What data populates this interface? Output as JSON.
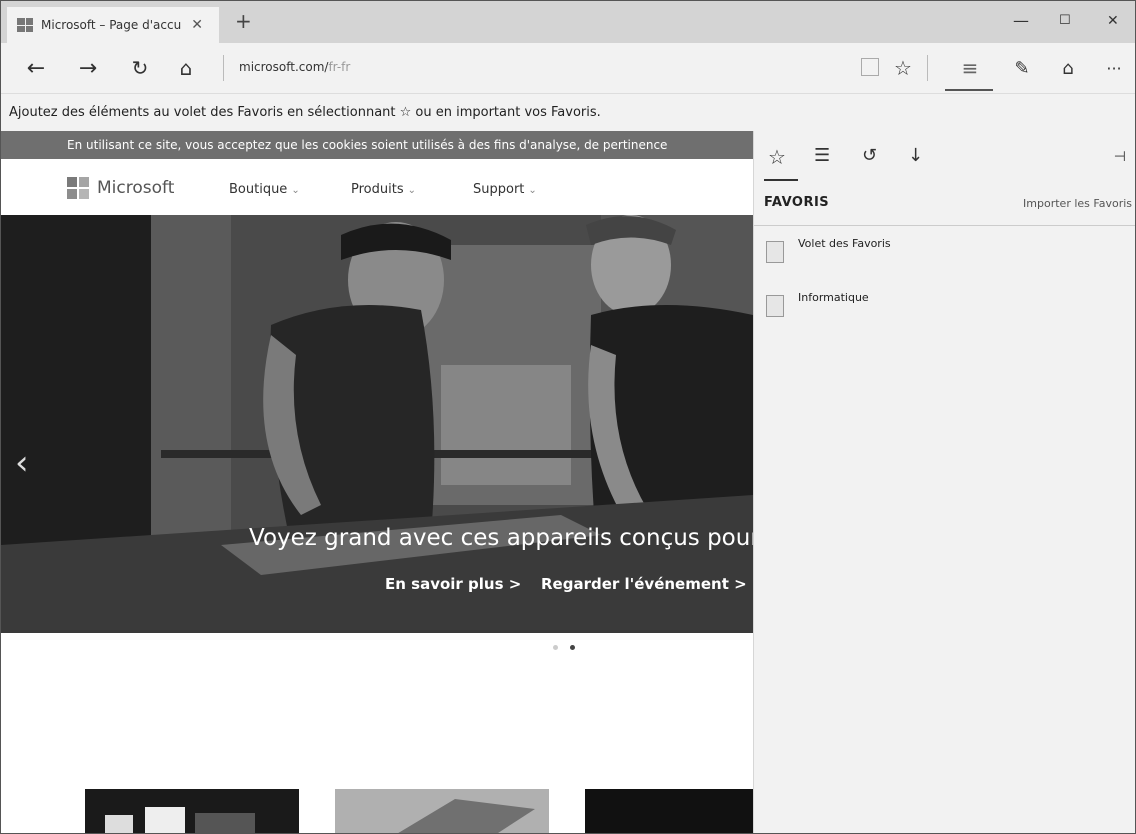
{
  "browser": {
    "tab": {
      "title": "Microsoft – Page d'accu",
      "close": "✕"
    },
    "new_tab": "+",
    "window_controls": {
      "minimize": "—",
      "maximize": "☐",
      "close": "✕"
    },
    "nav": {
      "back": "←",
      "forward": "→",
      "refresh": "↻",
      "home": "⌂",
      "url_main": "microsoft.com/",
      "url_path": "fr-fr",
      "favorite_star": "☆",
      "hub": "≡",
      "note": "✎",
      "share": "⌂",
      "more": "···"
    },
    "favorites_bar_hint": "Ajoutez des éléments au volet des Favoris en sélectionnant ☆ ou en important vos Favoris."
  },
  "page": {
    "cookie_banner": "En utilisant ce site, vous acceptez que les cookies soient utilisés à des fins d'analyse, de pertinence",
    "nav": {
      "brand": "Microsoft",
      "items": [
        {
          "label": "Boutique"
        },
        {
          "label": "Produits"
        },
        {
          "label": "Support"
        }
      ]
    },
    "hero": {
      "prev": "‹",
      "title": "Voyez grand avec ces appareils conçus pour c",
      "link1": "En savoir plus >",
      "link2": "Regarder l'événement >"
    }
  },
  "hub": {
    "icons": [
      "star-icon",
      "reading-list-icon",
      "history-icon",
      "download-icon"
    ],
    "pin": "⊣",
    "heading": "FAVORIS",
    "import_link": "Importer les Favoris",
    "folders": [
      {
        "name": "Volet des Favoris"
      },
      {
        "name": "Informatique"
      }
    ]
  },
  "colors": {
    "chrome": "#d4d4d4",
    "toolbar": "#f2f2f2",
    "banner": "#6f6f6f",
    "hub_bg": "#f2f2f2"
  }
}
